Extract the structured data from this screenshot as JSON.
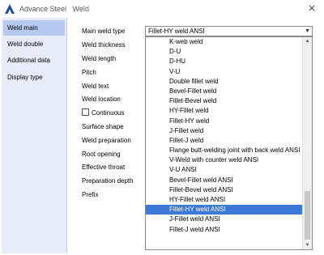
{
  "window": {
    "title": "Advance Steel   Weld",
    "close_symbol": "✕"
  },
  "sidebar": {
    "items": [
      {
        "label": "Weld main",
        "active": true
      },
      {
        "label": "Weld double",
        "active": false
      },
      {
        "label": "Additional data",
        "active": false
      },
      {
        "label": "Display type",
        "active": false
      }
    ]
  },
  "form": {
    "main_weld_type_label": "Main weld type",
    "weld_thickness_label": "Weld thickness",
    "weld_length_label": "Weld length",
    "pitch_label": "Pitch",
    "weld_text_label": "Weld text",
    "weld_location_label": "Weld location",
    "continuous_label": "Continuous",
    "surface_shape_label": "Surface shape",
    "weld_preparation_label": "Weld preparation",
    "root_opening_label": "Root opening",
    "effective_throat_label": "Effective throat",
    "preparation_depth_label": "Preparation depth",
    "prefix_label": "Prefix",
    "continuous_checked": false
  },
  "combo": {
    "value": "Fillet-HY weld ANSI",
    "arrow_icon": "chevron-down-icon"
  },
  "dropdown": {
    "options": [
      "K-web weld",
      "D-U",
      "D-HU",
      "V-U",
      "Double fillet weld",
      "Bevel-Fillet weld",
      "Fillet-Bevel weld",
      "HY-Fillet weld",
      "Fillet-HY weld",
      "J-Fillet weld",
      "Fillet-J weld",
      "Flange butt-welding joint with back weld ANSI",
      "V-Weld with counter weld ANSI",
      "V-U ANSI",
      "Bevel-Fillet weld ANSI",
      "Fillet-Bevel weld ANSI",
      "HY-Fillet weld ANSI",
      "Fillet-HY weld ANSI",
      "J-Fillet weld ANSI",
      "Fillet-J weld ANSI"
    ],
    "selected_index": 17
  },
  "colors": {
    "sidebar_bg": "#e8ecf8",
    "sidebar_active": "#b8c9ef",
    "selection": "#3c79d6",
    "brand_icon": "#1e4f9c"
  }
}
